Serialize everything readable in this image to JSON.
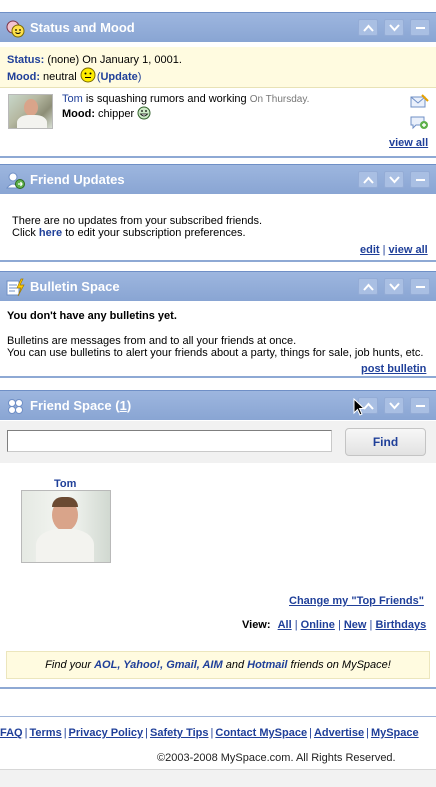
{
  "status_mood": {
    "title": "Status and Mood",
    "status_label": "Status:",
    "status_text": "(none) On January 1, 0001.",
    "mood_label": "Mood:",
    "mood_value": "neutral",
    "update_open": "(",
    "update_link": "Update",
    "update_close": ")",
    "friend_name": "Tom",
    "friend_text": "is squashing rumors and working",
    "friend_when": "On Thursday.",
    "friend_mood_label": "Mood:",
    "friend_mood_value": "chipper",
    "view_all": "view all"
  },
  "friend_updates": {
    "title": "Friend Updates",
    "line1": "There are no updates from your subscribed friends.",
    "line2_prefix": "Click",
    "line2_link": "here",
    "line2_suffix": "to edit your subscription preferences.",
    "edit": "edit",
    "separator": "|",
    "view_all": "view all"
  },
  "bulletin_space": {
    "title": "Bulletin Space",
    "empty": "You don't have any bulletins yet.",
    "desc1": "Bulletins are messages from and to all your friends at once.",
    "desc2": "You can use bulletins to alert your friends about a party, things for sale, job hunts, etc.",
    "post": "post bulletin"
  },
  "friend_space": {
    "title": "Friend Space (",
    "count": "1",
    "title_close": ")",
    "search_value": "",
    "find": "Find",
    "friend_name": "Tom",
    "change_top": "Change my \"Top Friends\"",
    "view_label": "View:",
    "view_links": [
      "All",
      "Online",
      "New",
      "Birthdays"
    ],
    "promo_prefix": "Find your",
    "promo_links": [
      "AOL, Yahoo!,",
      "Gmail, AIM"
    ],
    "promo_and": "and",
    "promo_hotmail": "Hotmail",
    "promo_suffix": "friends on MySpace!"
  },
  "footer": {
    "links": [
      "FAQ",
      "Terms",
      "Privacy Policy",
      "Safety Tips",
      "Contact MySpace",
      "Advertise",
      "MySpace"
    ],
    "separator": "|",
    "copyright": "©2003-2008 MySpace.com. All Rights Reserved."
  },
  "colors": {
    "header": "#8ea9d4",
    "link": "#1f3f99",
    "highlight": "#fffbe0"
  }
}
